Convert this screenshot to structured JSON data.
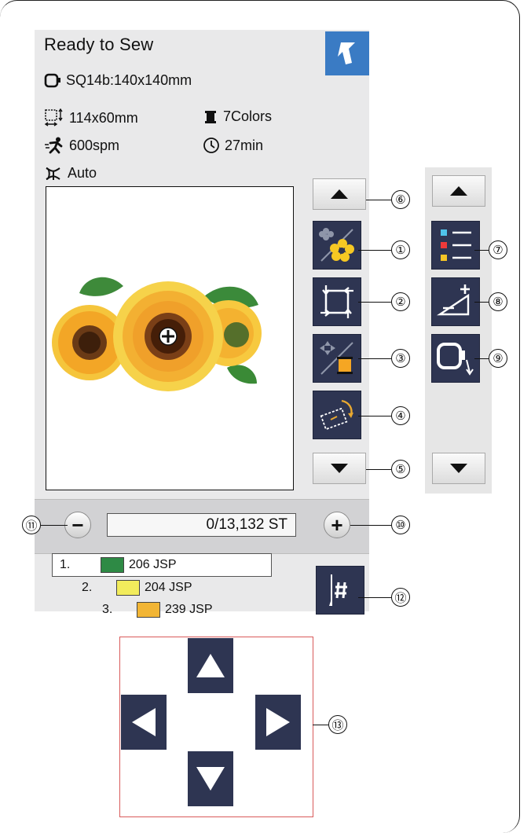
{
  "screen": {
    "title": "Ready to Sew",
    "hoop_label": "SQ14b:140x140mm",
    "size_label": "114x60mm",
    "colors_label": "7Colors",
    "speed_label": "600spm",
    "time_label": "27min",
    "cutter_label": "Auto"
  },
  "stitch_counter": {
    "value": "0/13,132 ST",
    "minus_label": "−",
    "plus_label": "+"
  },
  "color_list": [
    {
      "index": "1.",
      "code": "206 JSP",
      "color": "#2e8a45"
    },
    {
      "index": "2.",
      "code": "204 JSP",
      "color": "#f2ec5c"
    },
    {
      "index": "3.",
      "code": "239 JSP",
      "color": "#f2b534"
    }
  ],
  "callouts": {
    "c1": "①",
    "c2": "②",
    "c3": "③",
    "c4": "④",
    "c5": "⑤",
    "c6": "⑥",
    "c7": "⑦",
    "c8": "⑧",
    "c9": "⑨",
    "c10": "⑩",
    "c11": "⑪",
    "c12": "⑫",
    "c13": "⑬"
  },
  "icons": {
    "back": "return-arrow-icon",
    "hoop": "hoop-icon",
    "size": "design-size-icon",
    "spool": "thread-spool-icon",
    "speed": "running-man-icon",
    "clock": "clock-icon",
    "cutter": "thread-cutter-icon",
    "flower_toggle": "monochrome-flower-icon",
    "trace": "trace-frame-icon",
    "color_skip": "color-skip-icon",
    "rotate": "rotate-hoop-icon",
    "color_list": "color-list-icon",
    "tension": "tension-icon",
    "hoop_return": "hoop-return-icon",
    "stitch_jump": "needle-jump-icon",
    "jog": "jog-arrow-icon"
  },
  "colors": {
    "button_navy": "#2e3552",
    "back_blue": "#3a7bc4",
    "screen_bg": "#e9e9ea",
    "jog_frame": "#d95a5a"
  }
}
